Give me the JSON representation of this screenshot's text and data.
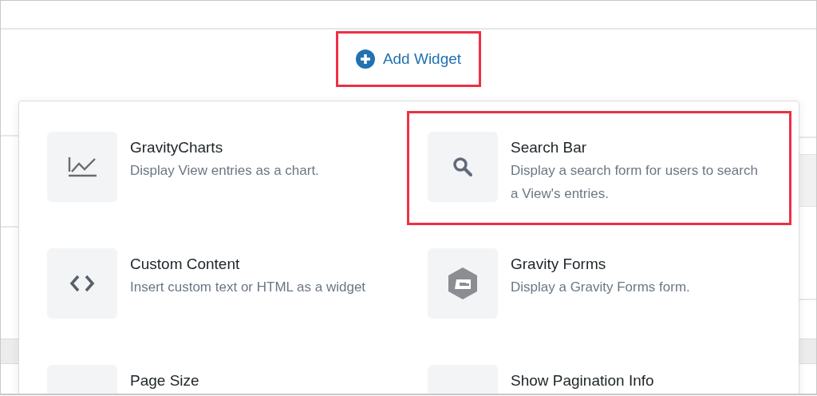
{
  "add_widget": {
    "label": "Add Widget",
    "highlighted": true
  },
  "widgets": [
    {
      "kind": "chart",
      "title": "GravityCharts",
      "description": "Display View entries as a chart.",
      "highlighted": false
    },
    {
      "kind": "search",
      "title": "Search Bar",
      "description": "Display a search form for users to search a View's entries.",
      "highlighted": true
    },
    {
      "kind": "code",
      "title": "Custom Content",
      "description": "Insert custom text or HTML as a widget",
      "highlighted": false
    },
    {
      "kind": "form",
      "title": "Gravity Forms",
      "description": "Display a Gravity Forms form.",
      "highlighted": false
    },
    {
      "kind": "blank",
      "title": "Page Size",
      "highlighted": false
    },
    {
      "kind": "blank",
      "title": "Show Pagination Info",
      "highlighted": false
    }
  ]
}
